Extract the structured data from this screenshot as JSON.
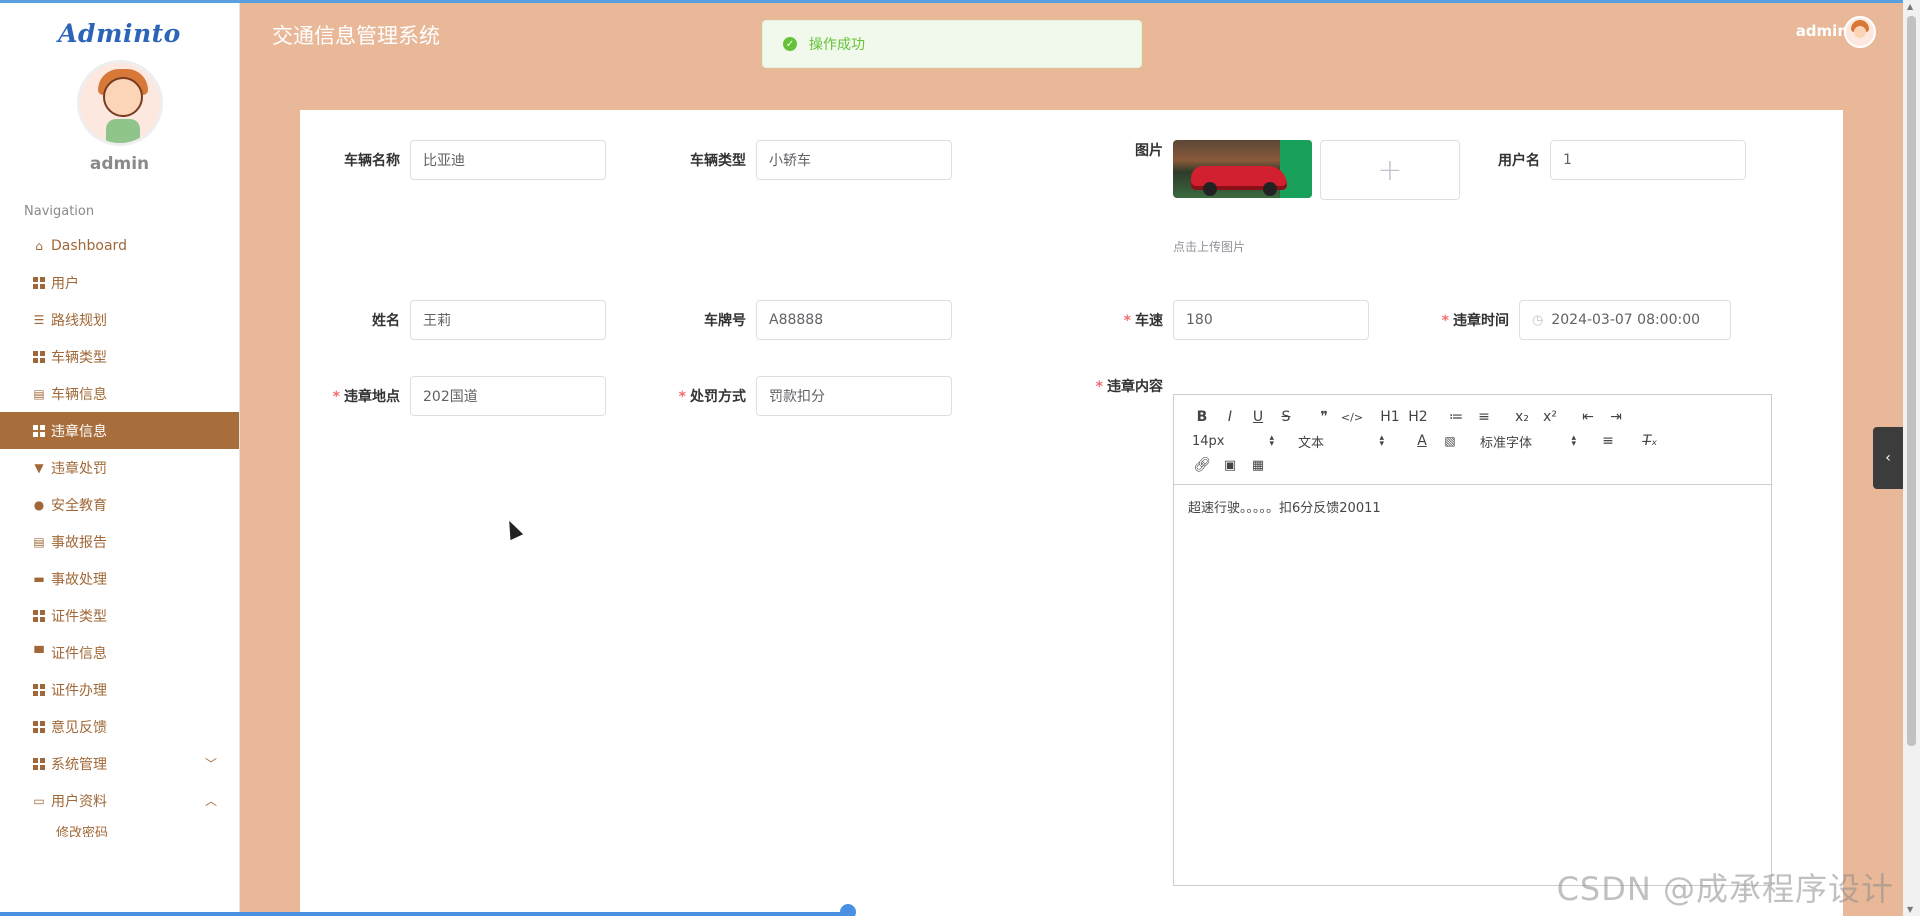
{
  "app": {
    "logo": "Adminto",
    "title": "交通信息管理系统",
    "user": "admin"
  },
  "toast": {
    "message": "操作成功"
  },
  "sidebar": {
    "user": "admin",
    "nav_title": "Navigation",
    "items": [
      {
        "label": "Dashboard",
        "icon": "home-icon"
      },
      {
        "label": "用户",
        "icon": "grid-icon"
      },
      {
        "label": "路线规划",
        "icon": "list-icon"
      },
      {
        "label": "车辆类型",
        "icon": "grid-icon"
      },
      {
        "label": "车辆信息",
        "icon": "clipboard-icon"
      },
      {
        "label": "违章信息",
        "icon": "grid-icon",
        "active": true
      },
      {
        "label": "违章处罚",
        "icon": "pin-icon"
      },
      {
        "label": "安全教育",
        "icon": "bulb-icon"
      },
      {
        "label": "事故报告",
        "icon": "clipboard-icon"
      },
      {
        "label": "事故处理",
        "icon": "ticket-icon"
      },
      {
        "label": "证件类型",
        "icon": "grid-icon"
      },
      {
        "label": "证件信息",
        "icon": "comment-icon"
      },
      {
        "label": "证件办理",
        "icon": "grid-icon"
      },
      {
        "label": "意见反馈",
        "icon": "grid-icon"
      },
      {
        "label": "系统管理",
        "icon": "grid-icon",
        "chevron": "down"
      },
      {
        "label": "用户资料",
        "icon": "card-icon",
        "chevron": "up"
      }
    ],
    "sub_item": "修改密码"
  },
  "form": {
    "vehicle_name": {
      "label": "车辆名称",
      "value": "比亚迪"
    },
    "vehicle_type": {
      "label": "车辆类型",
      "value": "小轿车"
    },
    "image": {
      "label": "图片",
      "tip": "点击上传图片",
      "plus": "+"
    },
    "username": {
      "label": "用户名",
      "value": "1"
    },
    "name": {
      "label": "姓名",
      "value": "王莉"
    },
    "plate": {
      "label": "车牌号",
      "value": "A88888"
    },
    "speed": {
      "label": "车速",
      "value": "180",
      "required": true
    },
    "time": {
      "label": "违章时间",
      "value": "2024-03-07 08:00:00",
      "required": true
    },
    "location": {
      "label": "违章地点",
      "value": "202国道",
      "required": true
    },
    "penalty": {
      "label": "处罚方式",
      "value": "罚款扣分",
      "required": true
    },
    "content": {
      "label": "违章内容",
      "value": "超速行驶。。。。。扣6分反馈20011",
      "required": true
    }
  },
  "editor": {
    "font_size": "14px",
    "block_type": "文本",
    "font_family": "标准字体",
    "tools_row1": [
      "B",
      "I",
      "U",
      "S",
      "❞",
      "</>",
      "H1",
      "H2",
      "≔",
      "≡",
      "x₂",
      "x²",
      "⇤",
      "⇥"
    ]
  },
  "watermark": "CSDN @成承程序设计",
  "required_mark": "*"
}
